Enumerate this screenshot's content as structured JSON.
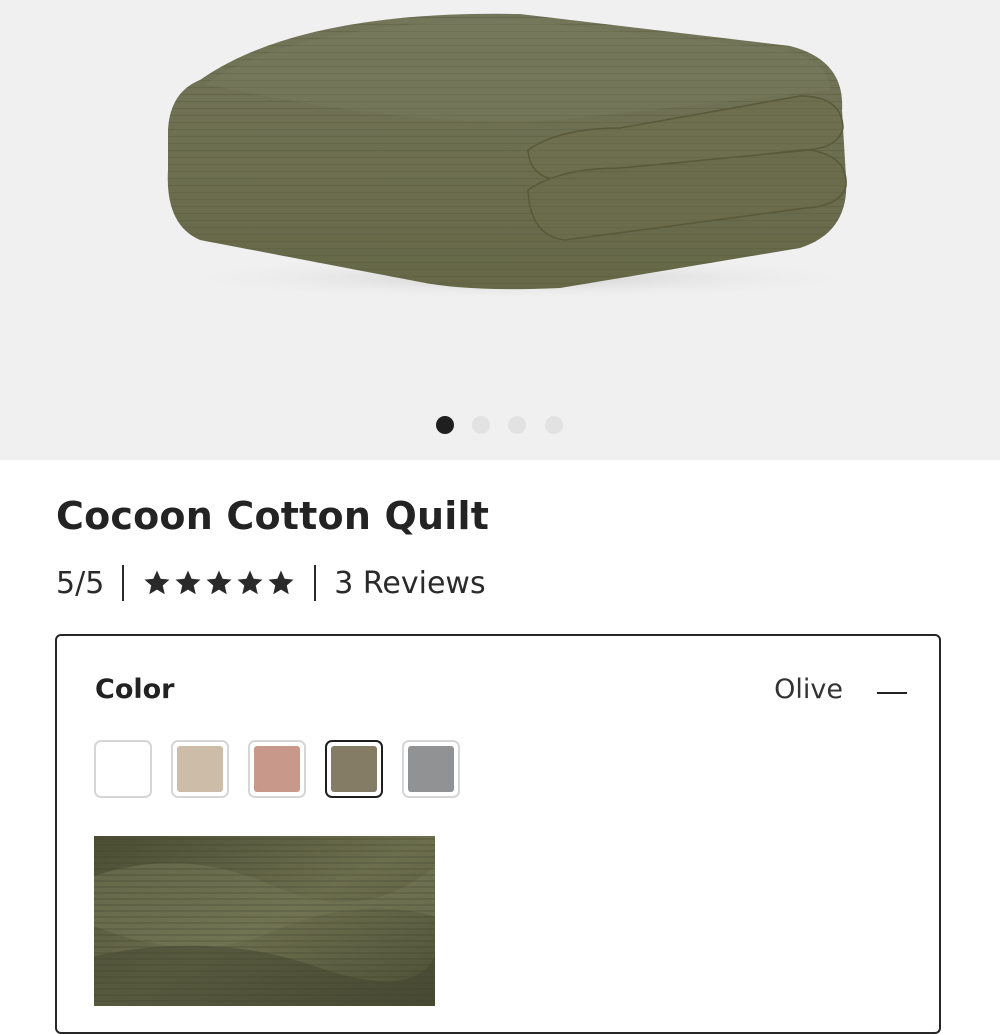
{
  "product": {
    "title": "Cocoon Cotton Quilt",
    "rating_text": "5/5",
    "rating": 5,
    "rating_max": 5,
    "reviews_text": "3 Reviews"
  },
  "gallery": {
    "image_count": 4,
    "active_index": 0
  },
  "color_option": {
    "label": "Color",
    "selected_value": "Olive",
    "swatches": [
      {
        "color": "#ffffff"
      },
      {
        "color": "#cdbca8"
      },
      {
        "color": "#c8998a"
      },
      {
        "color": "#857c66"
      },
      {
        "color": "#919294"
      }
    ],
    "selected_index": 3
  },
  "colors": {
    "quilt": "#6b6d4c",
    "text": "#232323",
    "hero_bg": "#f0f0f0"
  }
}
